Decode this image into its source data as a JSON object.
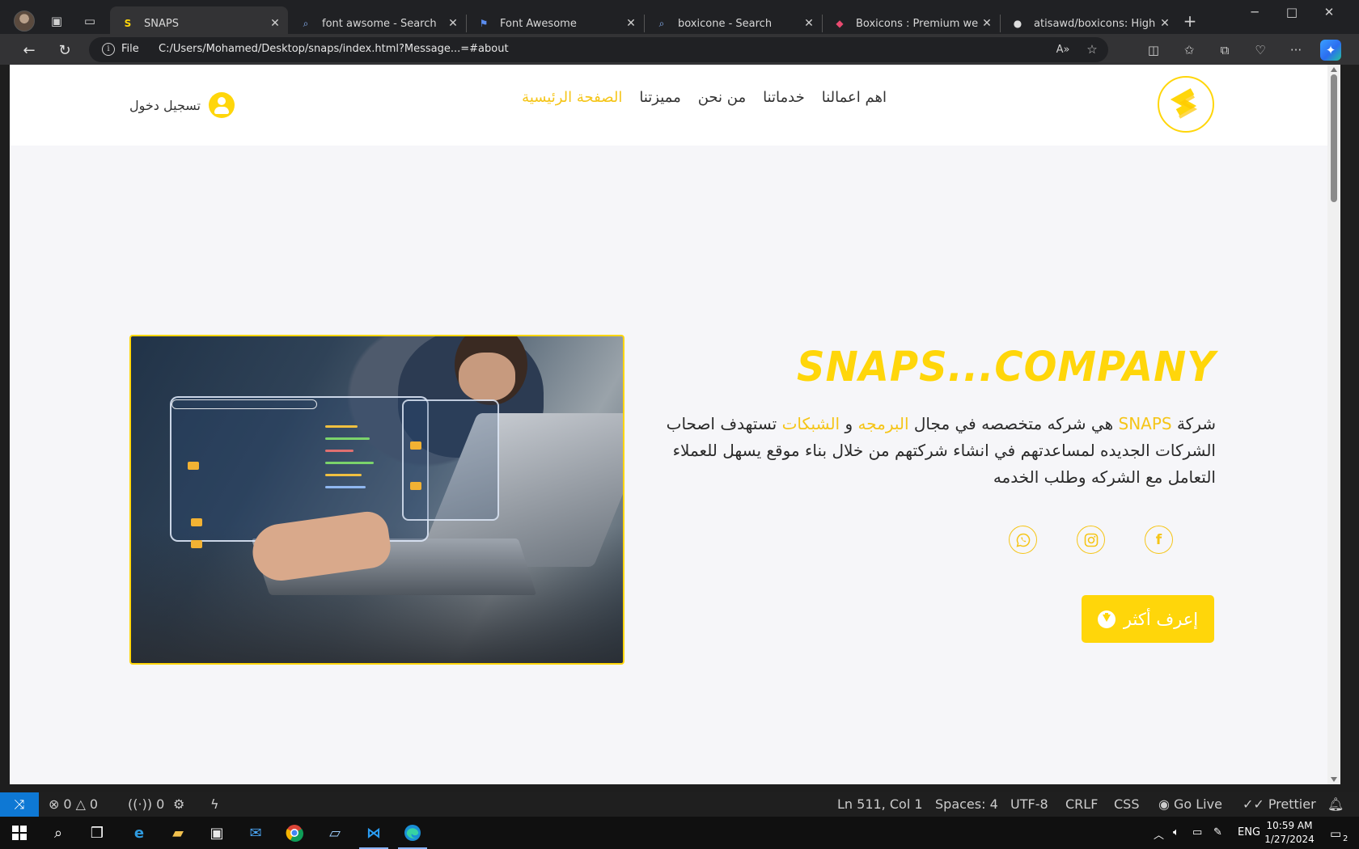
{
  "browser": {
    "tabs": [
      {
        "label": "SNAPS",
        "favicon": "snaps-logo"
      },
      {
        "label": "font awsome - Search",
        "favicon": "search-icon"
      },
      {
        "label": "Font Awesome",
        "favicon": "flag-icon"
      },
      {
        "label": "boxicone - Search",
        "favicon": "search-icon"
      },
      {
        "label": "Boxicons : Premium web frien",
        "favicon": "boxicons-icon"
      },
      {
        "label": "atisawd/boxicons: High Quali",
        "favicon": "github-icon"
      }
    ],
    "address": {
      "scheme_label": "File",
      "url": "C:/Users/Mohamed/Desktop/snaps/index.html?Message...=#about"
    }
  },
  "site": {
    "nav": {
      "items": [
        "الصفحة الرئيسية",
        "مميزتنا",
        "من نحن",
        "خدماتنا",
        "اهم اعمالنا"
      ],
      "active_index": 0
    },
    "login_label": "تسجيل دخول",
    "hero": {
      "title": "SNAPS...COMPANY",
      "paragraph": {
        "p1": "شركة ",
        "brand": "SNAPS",
        "p2": " هي شركه متخصصه في مجال ",
        "hl1": "البرمجه",
        "p3": " و ",
        "hl2": "الشبكات",
        "p4": " تستهدف اصحاب الشركات الجديده لمساعدتهم في انشاء شركتهم من خلال بناء موقع يسهل للعملاء التعامل مع الشركه وطلب الخدمه"
      },
      "social": [
        "facebook-icon",
        "instagram-icon",
        "whatsapp-icon"
      ],
      "button_label": "إعرف أكثر"
    },
    "colors": {
      "accent": "#ffd60a",
      "accent_text": "#f5c518"
    }
  },
  "statusbar": {
    "errors": "0",
    "warnings": "0",
    "ports": "0",
    "cursor": "Ln 511, Col 1",
    "spaces": "Spaces: 4",
    "encoding": "UTF-8",
    "eol": "CRLF",
    "language": "CSS",
    "golive": "Go Live",
    "prettier": "Prettier"
  },
  "taskbar": {
    "lang": "ENG",
    "time": "10:59 AM",
    "date": "1/27/2024",
    "notifications": "2"
  }
}
